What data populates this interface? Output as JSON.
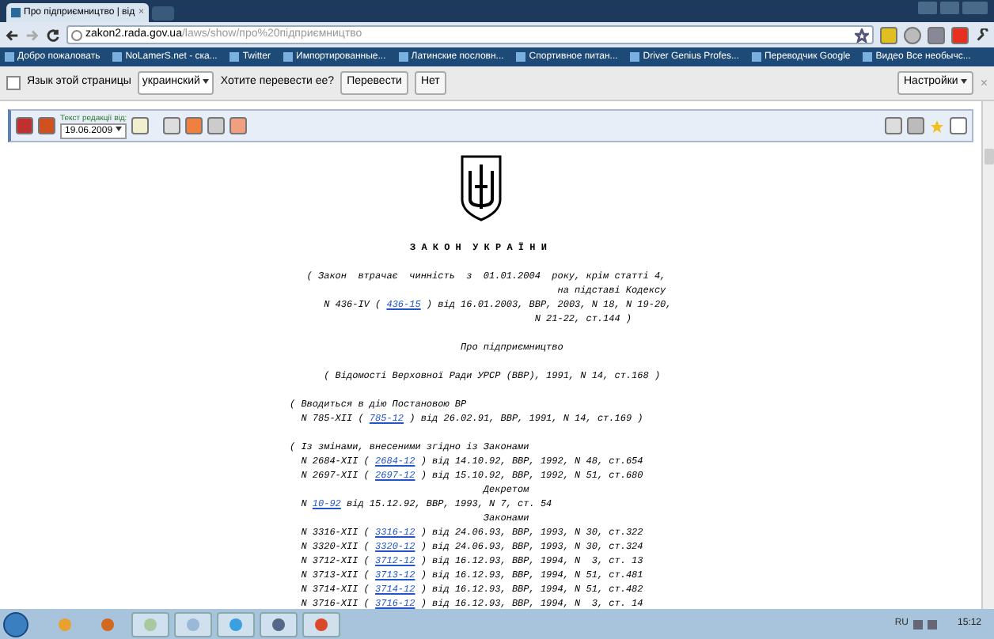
{
  "tab": {
    "title": "Про підприємництво | від",
    "close": "×"
  },
  "address": {
    "domain": "zakon2.rada.gov.ua",
    "path": "/laws/show/про%20підприємництво"
  },
  "bookmarks": [
    "Добро пожаловать",
    "NoLamerS.net - ска...",
    "Twitter",
    "Импортированные...",
    "Латинские пословн...",
    "Спортивное питан...",
    "Driver Genius Profes...",
    "Переводчик Google",
    "Видео Все необычс..."
  ],
  "translate_bar": {
    "label": "Язык этой страницы",
    "language": "украинский",
    "question": "Хотите перевести ее?",
    "buttons": [
      "Перевести",
      "Нет"
    ],
    "settings": "Настройки",
    "close": "×"
  },
  "doc_toolbar": {
    "label": "Текст редакції від:",
    "date": "19.06.2009"
  },
  "document": {
    "title": "З А К О Н  У К Р А Ї Н И",
    "blocks": [
      [
        [
          {
            "t": "   ( Закон  втрачає  чинність  з  01.01.2004  року, крім статті 4,"
          }
        ],
        [
          {
            "t": "                                               на підставі Кодексу"
          }
        ],
        [
          {
            "t": "      N 436-IV ( "
          },
          {
            "link": "436-15"
          },
          {
            "t": " ) від 16.01.2003, ВВР, 2003, N 18, N 19-20,"
          }
        ],
        [
          {
            "t": "                                           N 21-22, ст.144 )"
          }
        ]
      ],
      [
        [
          {
            "t": "                              Про підприємництво"
          }
        ]
      ],
      [
        [
          {
            "t": "      ( Відомості Верховної Ради УРСР (ВВР), 1991, N 14, ст.168 )"
          }
        ]
      ],
      [
        [
          {
            "t": "( Вводиться в дію Постановою ВР"
          }
        ],
        [
          {
            "t": "  N 785-XII ( "
          },
          {
            "link": "785-12"
          },
          {
            "t": " ) від 26.02.91, ВВР, 1991, N 14, ст.169 )"
          }
        ]
      ],
      [
        [
          {
            "t": "( Із змінами, внесеними згідно із Законами"
          }
        ],
        [
          {
            "t": "  N 2684-XII ( "
          },
          {
            "link": "2684-12"
          },
          {
            "t": " ) від 14.10.92, ВВР, 1992, N 48, ст.654"
          }
        ],
        [
          {
            "t": "  N 2697-XII ( "
          },
          {
            "link": "2697-12"
          },
          {
            "t": " ) від 15.10.92, ВВР, 1992, N 51, ст.680"
          }
        ],
        [
          {
            "t": "                                  Декретом"
          }
        ],
        [
          {
            "t": "  N "
          },
          {
            "link": "10-92"
          },
          {
            "t": " від 15.12.92, ВВР, 1993, N 7, ст. 54"
          }
        ],
        [
          {
            "t": "                                  Законами"
          }
        ],
        [
          {
            "t": "  N 3316-XII ( "
          },
          {
            "link": "3316-12"
          },
          {
            "t": " ) від 24.06.93, ВВР, 1993, N 30, ст.322"
          }
        ],
        [
          {
            "t": "  N 3320-XII ( "
          },
          {
            "link": "3320-12"
          },
          {
            "t": " ) від 24.06.93, ВВР, 1993, N 30, ст.324"
          }
        ],
        [
          {
            "t": "  N 3712-XII ( "
          },
          {
            "link": "3712-12"
          },
          {
            "t": " ) від 16.12.93, ВВР, 1994, N  3, ст. 13"
          }
        ],
        [
          {
            "t": "  N 3713-XII ( "
          },
          {
            "link": "3713-12"
          },
          {
            "t": " ) від 16.12.93, ВВР, 1994, N 51, ст.481"
          }
        ],
        [
          {
            "t": "  N 3714-XII ( "
          },
          {
            "link": "3714-12"
          },
          {
            "t": " ) від 16.12.93, ВВР, 1994, N 51, ст.482"
          }
        ],
        [
          {
            "t": "  N 3716-XII ( "
          },
          {
            "link": "3716-12"
          },
          {
            "t": " ) від 16.12.93, ВВР, 1994, N  3, ст. 14"
          }
        ]
      ]
    ]
  },
  "taskbar": {
    "apps": [
      {
        "selected": false
      },
      {
        "selected": false
      },
      {
        "selected": true
      },
      {
        "selected": true
      },
      {
        "selected": true
      },
      {
        "selected": true
      },
      {
        "selected": true
      }
    ],
    "language": "RU",
    "time": "15:12"
  }
}
